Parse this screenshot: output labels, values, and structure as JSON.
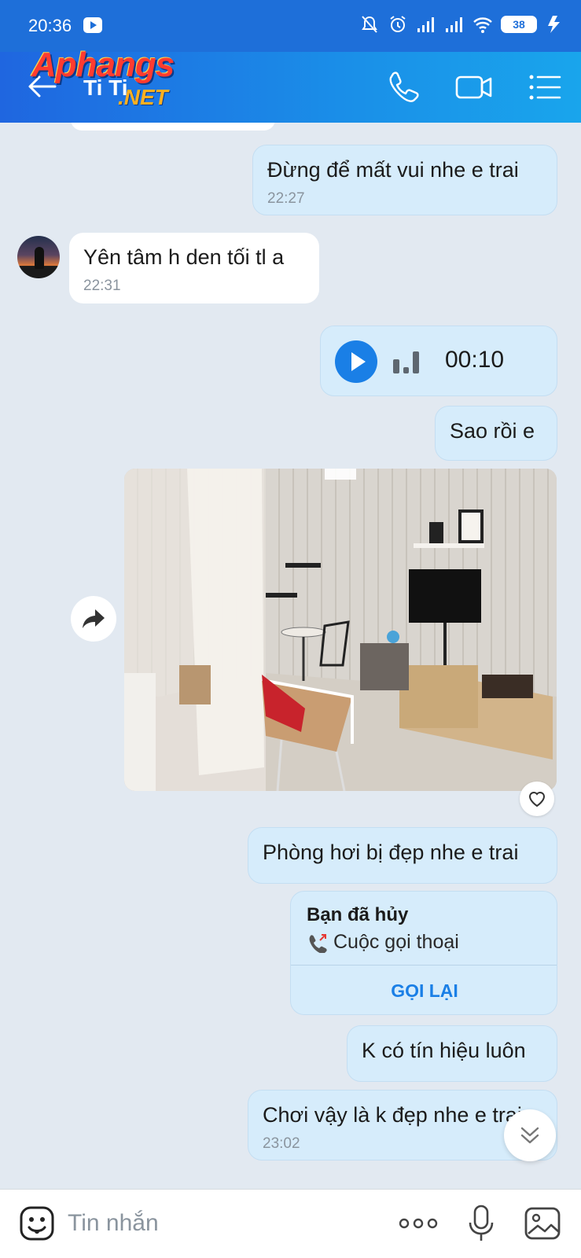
{
  "status_bar": {
    "time": "20:36",
    "battery": "38"
  },
  "header": {
    "logo_main": "Aphangs",
    "logo_sub": "Ti Ti",
    "logo_net": ".NET"
  },
  "messages": [
    {
      "type": "text",
      "direction": "out",
      "text": "Đừng để mất vui nhe e trai",
      "time": "22:27"
    },
    {
      "type": "text",
      "direction": "in",
      "text": "Yên tâm h den tối tl a",
      "time": "22:31"
    },
    {
      "type": "voice",
      "direction": "out",
      "duration": "00:10"
    },
    {
      "type": "text",
      "direction": "out",
      "text": "Sao rồi e"
    },
    {
      "type": "image",
      "direction": "out"
    },
    {
      "type": "text",
      "direction": "out",
      "text": "Phòng hơi bị đẹp nhe e trai"
    },
    {
      "type": "call",
      "direction": "out",
      "title": "Bạn đã hủy",
      "subtitle": "Cuộc gọi thoại",
      "action": "GỌI LẠI"
    },
    {
      "type": "text",
      "direction": "out",
      "text": "K có tín hiệu luôn"
    },
    {
      "type": "text",
      "direction": "out",
      "text": "Chơi vậy là k đẹp nhe e trai",
      "time": "23:02"
    }
  ],
  "input": {
    "placeholder": "Tin nhắn"
  },
  "colors": {
    "header": "#1e6fd9",
    "accent": "#1a7fe6",
    "bubble_out": "#d6ecfb",
    "background": "#e2e9f1"
  }
}
